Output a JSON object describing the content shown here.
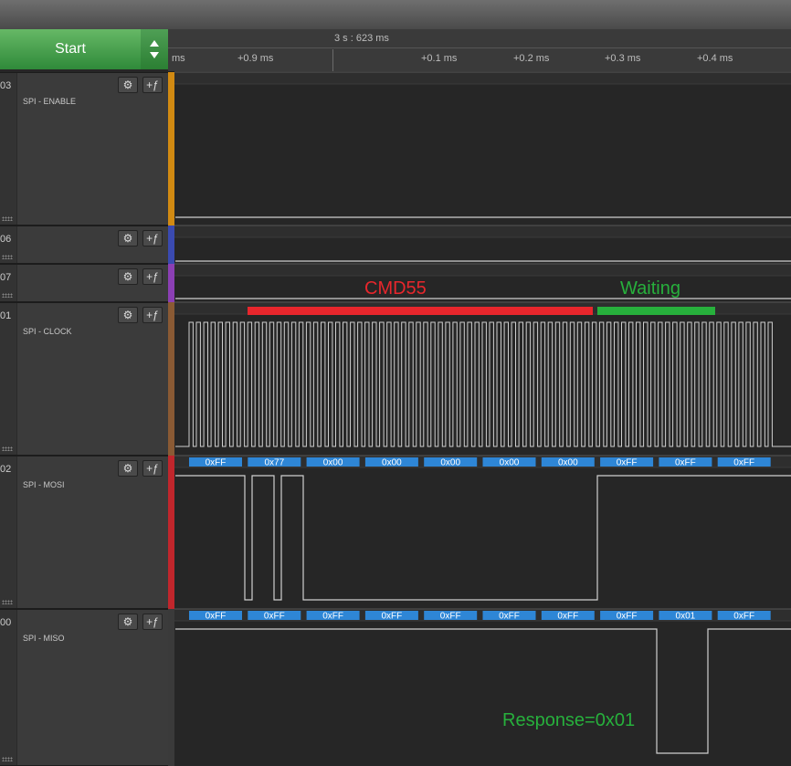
{
  "toolbar": {
    "start_label": "Start"
  },
  "ruler": {
    "capture_time": "3 s : 623 ms",
    "ticks": [
      "ms",
      "+0.9 ms",
      "+0.1 ms",
      "+0.2 ms",
      "+0.3 ms",
      "+0.4 ms"
    ]
  },
  "channels": [
    {
      "num": "03",
      "name": "SPI - ENABLE",
      "color": "#d18a12"
    },
    {
      "num": "06",
      "name": "",
      "color": "#3a4ab0"
    },
    {
      "num": "07",
      "name": "",
      "color": "#8b3fb4"
    },
    {
      "num": "01",
      "name": "SPI - CLOCK",
      "color": "#8a5a34"
    },
    {
      "num": "02",
      "name": "SPI - MOSI",
      "color": "#c0262c"
    },
    {
      "num": "00",
      "name": "SPI - MISO",
      "color": "#3a3a3a"
    }
  ],
  "mosi_bytes": [
    "0xFF",
    "0x77",
    "0x00",
    "0x00",
    "0x00",
    "0x00",
    "0x00",
    "0xFF",
    "0xFF",
    "0xFF"
  ],
  "miso_bytes": [
    "0xFF",
    "0xFF",
    "0xFF",
    "0xFF",
    "0xFF",
    "0xFF",
    "0xFF",
    "0xFF",
    "0x01",
    "0xFF"
  ],
  "annotations": {
    "cmd_label": "CMD55",
    "waiting_label": "Waiting",
    "response_label": "Response=0x01"
  },
  "colors": {
    "accent_green": "#2f8a3a",
    "cmd_red": "#e8262c",
    "waiting_green": "#27b03c",
    "decode_blue": "#2e86d6",
    "wave_stroke": "#cfcfcf"
  }
}
